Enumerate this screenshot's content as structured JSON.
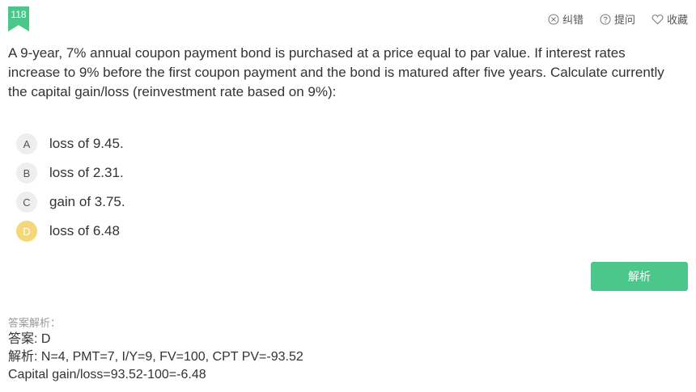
{
  "question": {
    "number": "118",
    "text": "A 9-year, 7% annual coupon payment bond is purchased at a price equal to par value. If interest rates increase to 9% before the first coupon payment and the bond is matured after five years. Calculate currently the capital gain/loss (reinvestment rate based on 9%):"
  },
  "toolbar": {
    "report_label": "纠错",
    "hint_label": "提问",
    "favorite_label": "收藏"
  },
  "options": [
    {
      "letter": "A",
      "text": "loss of 9.45.",
      "selected": false
    },
    {
      "letter": "B",
      "text": "loss of 2.31.",
      "selected": false
    },
    {
      "letter": "C",
      "text": "gain of 3.75.",
      "selected": false
    },
    {
      "letter": "D",
      "text": "loss of 6.48",
      "selected": true
    }
  ],
  "analyze_button": "解析",
  "analysis": {
    "heading": "答案解析：",
    "answer": "答案: D",
    "explanation": "解析: N=4, PMT=7, I/Y=9, FV=100, CPT PV=-93.52",
    "extra": "Capital gain/loss=93.52-100=-6.48"
  },
  "colors": {
    "accent_green": "#4cc78b",
    "selected_option": "#f5d77a"
  }
}
